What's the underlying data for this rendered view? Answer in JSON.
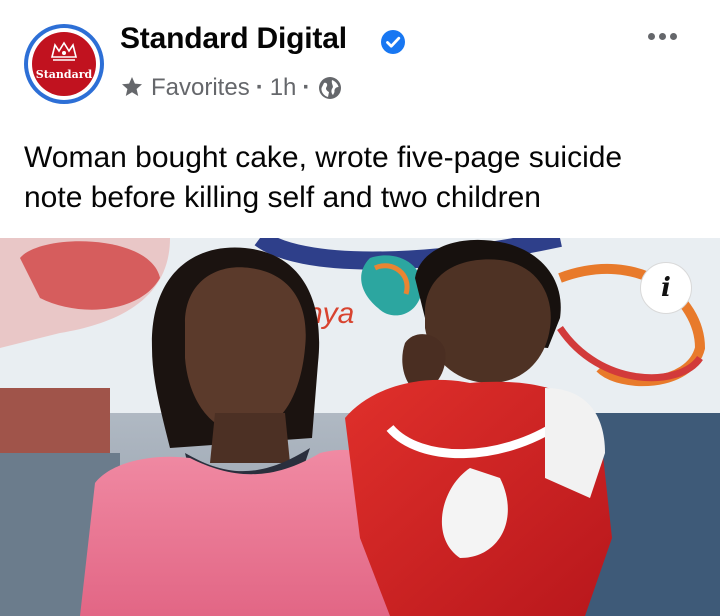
{
  "post": {
    "page_name": "Standard Digital",
    "verified": true,
    "audience_label": "Favorites",
    "separator": "·",
    "time_ago": "1h",
    "privacy_icon": "globe-icon",
    "more_icon": "more-dots-icon",
    "text_line1": "Woman bought cake, wrote five-page suicide",
    "text_line2": "note before killing self and two children"
  },
  "avatar": {
    "brand_text": "Standard"
  },
  "photo": {
    "info_icon": "i",
    "banner_text": "nya"
  },
  "colors": {
    "verified_blue": "#1877f2",
    "avatar_ring": "#2d6fd6",
    "avatar_red": "#c1121f",
    "meta_gray": "#65676b",
    "text_black": "#050505"
  }
}
